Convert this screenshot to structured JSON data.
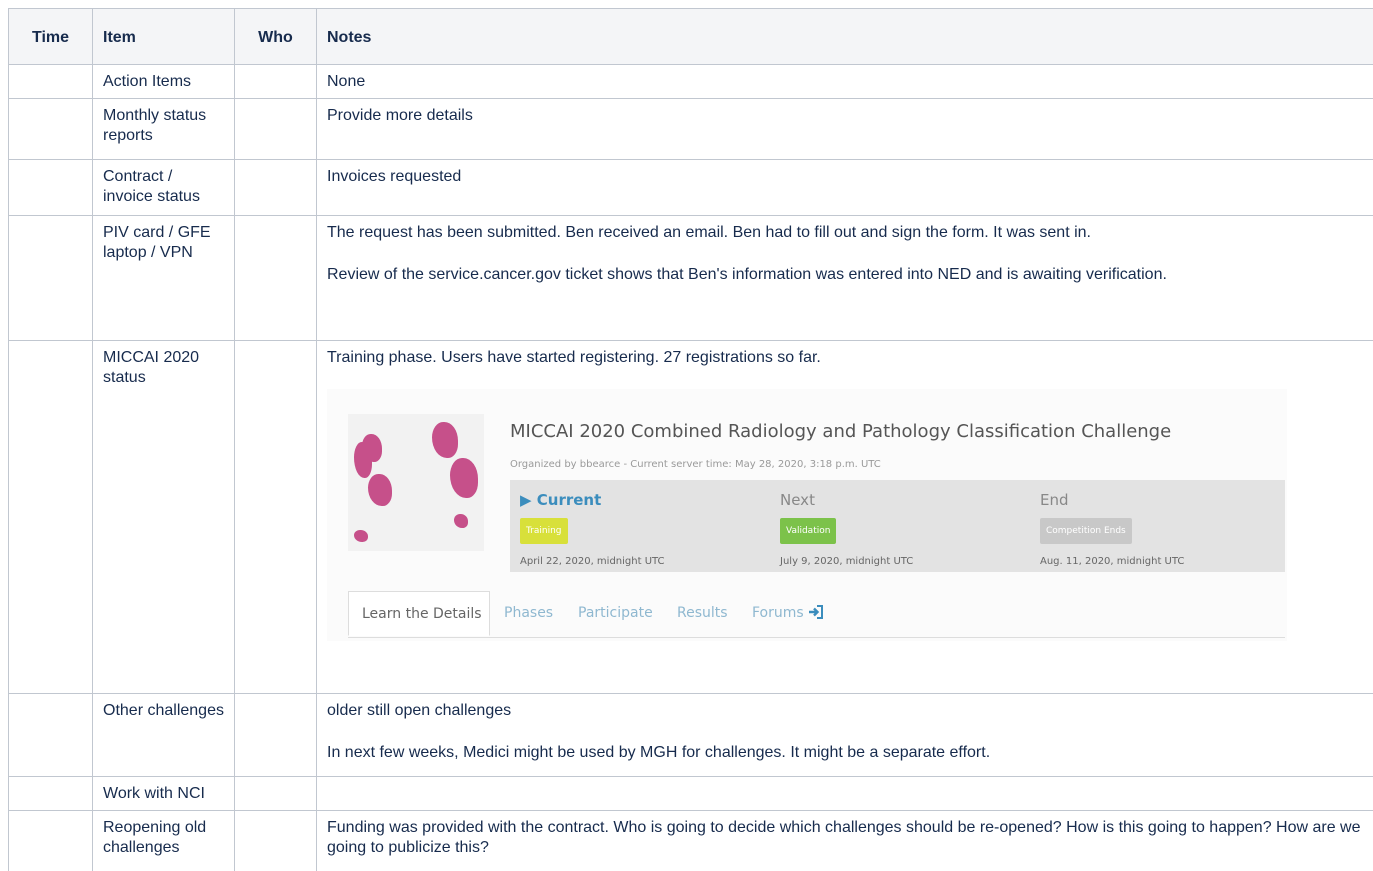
{
  "table": {
    "headers": {
      "time": "Time",
      "item": "Item",
      "who": "Who",
      "notes": "Notes"
    },
    "rows": [
      {
        "item": "Action Items",
        "notes": [
          "None"
        ]
      },
      {
        "item": "Monthly status reports",
        "notes": [
          "Provide more details"
        ]
      },
      {
        "item": "Contract / invoice status",
        "notes": [
          "Invoices requested"
        ]
      },
      {
        "item": "PIV card / GFE laptop / VPN",
        "notes": [
          "The request has been submitted. Ben received an email. Ben had to fill out and sign the form. It was sent in.",
          "Review of the service.cancer.gov ticket shows that Ben's information was entered into NED and is awaiting verification."
        ]
      },
      {
        "item": "MICCAI 2020 status",
        "notes": [
          "Training phase. Users have started registering. 27 registrations so far."
        ]
      },
      {
        "item": "Other challenges",
        "notes": [
          "older still open challenges",
          "In next few weeks, Medici might be used by MGH for challenges. It might be a separate effort."
        ]
      },
      {
        "item": "Work with NCI",
        "notes": []
      },
      {
        "item": "Reopening old challenges",
        "notes": [
          "Funding was provided with the contract. Who is going to decide which challenges should be re-opened? How is this going to happen? How are we going to publicize this?"
        ]
      }
    ]
  },
  "challenge": {
    "title": "MICCAI 2020 Combined Radiology and Pathology Classification Challenge",
    "organizer": "Organized by bbearce - Current server time: May 28, 2020, 3:18 p.m. UTC",
    "phases": [
      {
        "name": "▶ Current",
        "badge": "Training",
        "badge_color": "#d8e03a",
        "date": "April 22, 2020, midnight UTC"
      },
      {
        "name": "Next",
        "badge": "Validation",
        "badge_color": "#7cc24a",
        "date": "July 9, 2020, midnight UTC"
      },
      {
        "name": "End",
        "badge": "Competition Ends",
        "badge_color": "#c8c8c8",
        "date": "Aug. 11, 2020, midnight UTC"
      }
    ],
    "tabs": [
      "Learn the Details",
      "Phases",
      "Participate",
      "Results",
      "Forums"
    ],
    "forums_icon": "sign-in-icon"
  }
}
